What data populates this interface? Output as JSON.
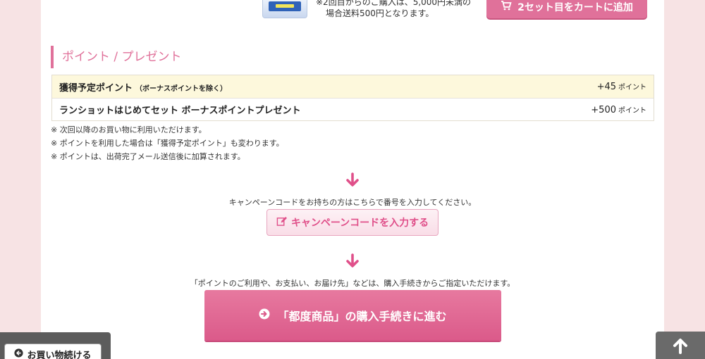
{
  "product": {
    "shipping_note_line1": "※2回目からのご購入は、5,000円未満の",
    "shipping_note_line2": "場合送料500円となります。",
    "cart_button_label": "2セット目をカートに追加"
  },
  "points_section": {
    "heading": "ポイント / プレゼント",
    "rows": [
      {
        "name": "獲得予定ポイント",
        "note": "（ボーナスポイントを除く）",
        "value": "+45",
        "unit": "ポイント"
      },
      {
        "name": "ランショットはじめてセット ボーナスポイントプレゼント",
        "note": "",
        "value": "+500",
        "unit": "ポイント"
      }
    ],
    "notes": [
      "次回以降のお買い物に利用いただけます。",
      "ポイントを利用した場合は「獲得予定ポイント」も変わります。",
      "ポイントは、出荷完了メール送信後に加算されます。"
    ]
  },
  "campaign": {
    "prompt": "キャンペーンコードをお持ちの方はこちらで番号を入力してください。",
    "button_label": "キャンペーンコードを入力する"
  },
  "checkout": {
    "prompt": "「ポイントのご利用や、お支払い、お届け先」などは、購入手続きからご指定いただけます。",
    "button_label": "「都度商品」の購入手続きに進む"
  },
  "footer": {
    "continue_label": "お買い物続ける"
  },
  "colors": {
    "accent": "#e0719a",
    "page_bg": "#f7e3e4",
    "highlight_row": "#fdf8dc"
  },
  "icons": [
    "cart-icon",
    "arrow-down-icon",
    "edit-icon",
    "circle-arrow-right-icon",
    "circle-arrow-left-icon",
    "arrow-up-icon"
  ]
}
